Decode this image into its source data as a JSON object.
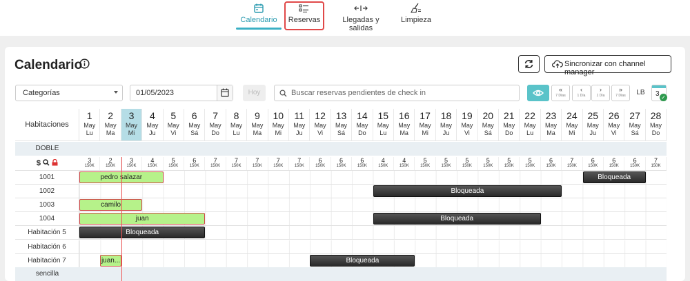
{
  "nav": {
    "items": [
      {
        "label": "Calendario",
        "icon": "calendar-icon",
        "active": true
      },
      {
        "label": "Reservas",
        "icon": "list-icon",
        "active": false
      },
      {
        "label": "Llegadas y salidas",
        "icon": "arrivals-departures-icon",
        "active": false
      },
      {
        "label": "Limpieza",
        "icon": "broom-icon",
        "active": false
      }
    ]
  },
  "page": {
    "title": "Calendario",
    "sync_label": "Sincronizar con channel manager"
  },
  "filters": {
    "category": "Categorías",
    "date": "01/05/2023",
    "today_label": "Hoy",
    "search_placeholder": "Buscar reservas pendientes de check in",
    "lb_label": "LB",
    "count": "3",
    "nav": [
      {
        "arrow": "«",
        "sub": "7 Días"
      },
      {
        "arrow": "‹",
        "sub": "1 Día"
      },
      {
        "arrow": "›",
        "sub": "1 Día"
      },
      {
        "arrow": "»",
        "sub": "7 Días"
      }
    ]
  },
  "grid": {
    "rooms_header": "Habitaciones",
    "selected_day_index": 2,
    "days": [
      {
        "n": "1",
        "m": "May",
        "d": "Lu"
      },
      {
        "n": "2",
        "m": "May",
        "d": "Ma"
      },
      {
        "n": "3",
        "m": "May",
        "d": "Mi"
      },
      {
        "n": "4",
        "m": "May",
        "d": "Ju"
      },
      {
        "n": "5",
        "m": "May",
        "d": "Vi"
      },
      {
        "n": "6",
        "m": "May",
        "d": "Sá"
      },
      {
        "n": "7",
        "m": "May",
        "d": "Do"
      },
      {
        "n": "8",
        "m": "May",
        "d": "Lu"
      },
      {
        "n": "9",
        "m": "May",
        "d": "Ma"
      },
      {
        "n": "10",
        "m": "May",
        "d": "Mi"
      },
      {
        "n": "11",
        "m": "May",
        "d": "Ju"
      },
      {
        "n": "12",
        "m": "May",
        "d": "Vi"
      },
      {
        "n": "13",
        "m": "May",
        "d": "Sá"
      },
      {
        "n": "14",
        "m": "May",
        "d": "Do"
      },
      {
        "n": "15",
        "m": "May",
        "d": "Lu"
      },
      {
        "n": "16",
        "m": "May",
        "d": "Ma"
      },
      {
        "n": "17",
        "m": "May",
        "d": "Mi"
      },
      {
        "n": "18",
        "m": "May",
        "d": "Ju"
      },
      {
        "n": "19",
        "m": "May",
        "d": "Vi"
      },
      {
        "n": "20",
        "m": "May",
        "d": "Sá"
      },
      {
        "n": "21",
        "m": "May",
        "d": "Do"
      },
      {
        "n": "22",
        "m": "May",
        "d": "Lu"
      },
      {
        "n": "23",
        "m": "May",
        "d": "Ma"
      },
      {
        "n": "24",
        "m": "May",
        "d": "Mi"
      },
      {
        "n": "25",
        "m": "May",
        "d": "Ju"
      },
      {
        "n": "26",
        "m": "May",
        "d": "Vi"
      },
      {
        "n": "27",
        "m": "May",
        "d": "Sá"
      },
      {
        "n": "28",
        "m": "May",
        "d": "Do"
      }
    ],
    "groups": [
      {
        "name": "DOBLE"
      },
      {
        "name": "sencilla"
      }
    ],
    "availability_icons": "$ 🔍 🔒",
    "availability": [
      {
        "a": "3",
        "p": "150K"
      },
      {
        "a": "2",
        "p": "150K"
      },
      {
        "a": "3",
        "p": "150K"
      },
      {
        "a": "4",
        "p": "150K"
      },
      {
        "a": "5",
        "p": "150K"
      },
      {
        "a": "6",
        "p": "150K"
      },
      {
        "a": "7",
        "p": "150K"
      },
      {
        "a": "7",
        "p": "150K"
      },
      {
        "a": "7",
        "p": "150K"
      },
      {
        "a": "7",
        "p": "150K"
      },
      {
        "a": "7",
        "p": "150K"
      },
      {
        "a": "6",
        "p": "150K"
      },
      {
        "a": "6",
        "p": "150K"
      },
      {
        "a": "6",
        "p": "150K"
      },
      {
        "a": "4",
        "p": "150K"
      },
      {
        "a": "4",
        "p": "150K"
      },
      {
        "a": "5",
        "p": "150K"
      },
      {
        "a": "5",
        "p": "150K"
      },
      {
        "a": "5",
        "p": "150K"
      },
      {
        "a": "5",
        "p": "150K"
      },
      {
        "a": "5",
        "p": "150K"
      },
      {
        "a": "5",
        "p": "150K"
      },
      {
        "a": "6",
        "p": "150K"
      },
      {
        "a": "7",
        "p": "150K"
      },
      {
        "a": "6",
        "p": "150K"
      },
      {
        "a": "6",
        "p": "150K"
      },
      {
        "a": "6",
        "p": "150K"
      },
      {
        "a": "7",
        "p": "150K"
      }
    ],
    "rooms": [
      {
        "name": "1001",
        "bookings": [
          {
            "label": "pedro salazar",
            "start": 0,
            "end": 4,
            "type": "guest"
          },
          {
            "label": "Bloqueada",
            "start": 24,
            "end": 27,
            "type": "blocked"
          }
        ]
      },
      {
        "name": "1002",
        "bookings": [
          {
            "label": "Bloqueada",
            "start": 14,
            "end": 23,
            "type": "blocked"
          }
        ]
      },
      {
        "name": "1003",
        "bookings": [
          {
            "label": "camilo",
            "start": 0,
            "end": 3,
            "type": "guest"
          }
        ]
      },
      {
        "name": "1004",
        "bookings": [
          {
            "label": "juan",
            "start": 0,
            "end": 6,
            "type": "guest"
          },
          {
            "label": "Bloqueada",
            "start": 14,
            "end": 22,
            "type": "blocked"
          }
        ]
      },
      {
        "name": "Habitación 5",
        "bookings": [
          {
            "label": "Bloqueada",
            "start": 0,
            "end": 6,
            "type": "blocked"
          }
        ]
      },
      {
        "name": "Habitación 6",
        "bookings": []
      },
      {
        "name": "Habitación 7",
        "bookings": [
          {
            "label": "juan...",
            "start": 1,
            "end": 2,
            "type": "guest"
          },
          {
            "label": "Bloqueada",
            "start": 11,
            "end": 16,
            "type": "blocked"
          }
        ]
      }
    ]
  }
}
